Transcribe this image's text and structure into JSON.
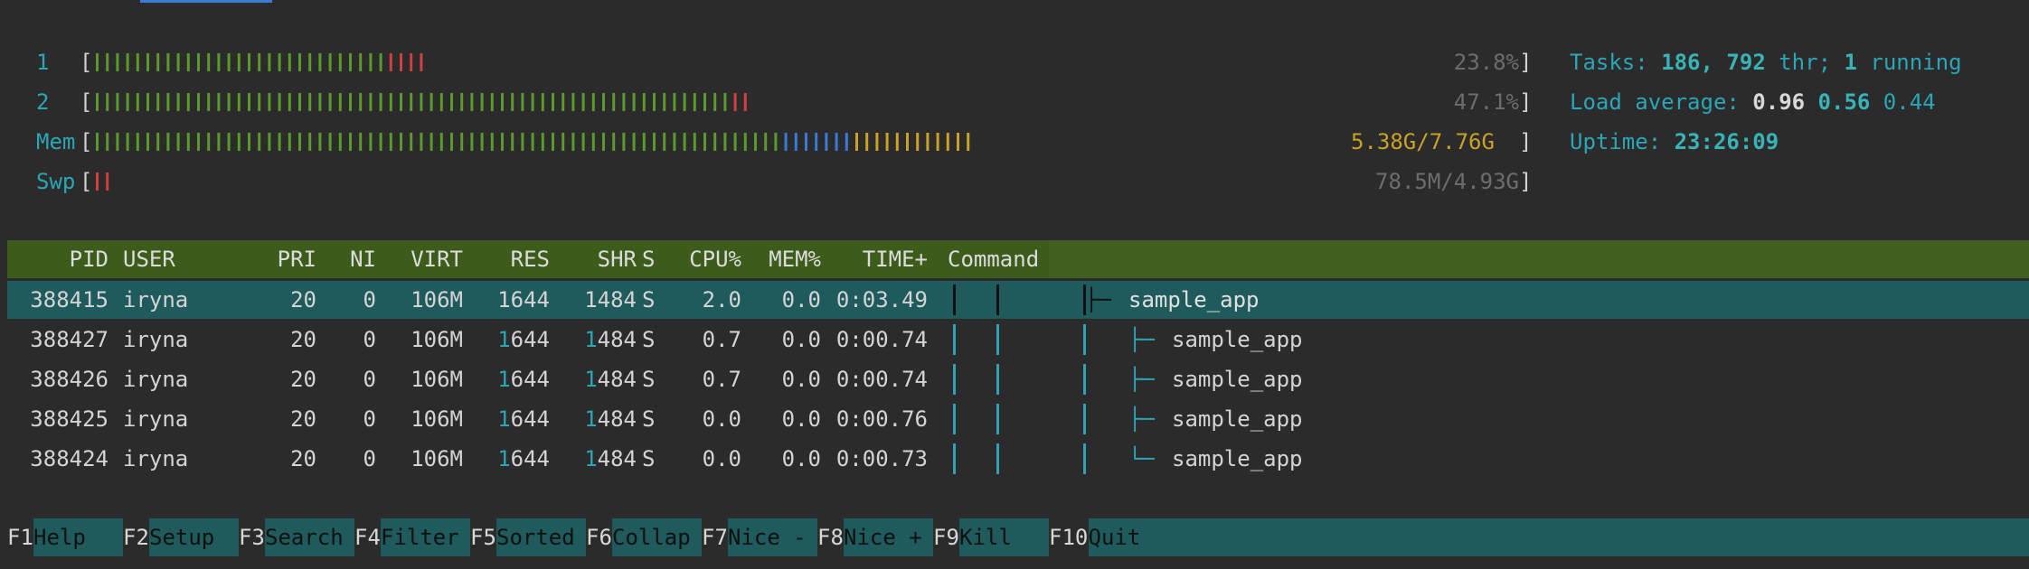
{
  "meters": {
    "cpu1": {
      "label": "1",
      "percent": 23.8,
      "value": "23.8%"
    },
    "cpu2": {
      "label": "2",
      "percent": 47.1,
      "value": "47.1%"
    },
    "mem": {
      "label": "Mem",
      "value": "5.38G/7.76G"
    },
    "swp": {
      "label": "Swp",
      "value": "78.5M/4.93G"
    }
  },
  "stats": {
    "tasks_label": "Tasks: ",
    "tasks_count": "186",
    "tasks_sep1": ", ",
    "threads": "792",
    "tasks_sep2": " thr; ",
    "running": "1",
    "running_label": " running",
    "load_label": "Load average: ",
    "load1": "0.96",
    "load5": "0.56",
    "load15": "0.44",
    "uptime_label": "Uptime: ",
    "uptime": "23:26:09"
  },
  "columns": {
    "pid": "PID",
    "user": "USER",
    "pri": "PRI",
    "ni": "NI",
    "virt": "VIRT",
    "res": "RES",
    "shr": "SHR",
    "s": "S",
    "cpu": "CPU%",
    "mem": "MEM%",
    "time": "TIME+",
    "command": "Command"
  },
  "processes": [
    {
      "pid": "388415",
      "user": "iryna",
      "pri": "20",
      "ni": "0",
      "virt": "106M",
      "res_a": "1",
      "res_b": "644",
      "shr_a": "1",
      "shr_b": "484",
      "s": "S",
      "cpu": "2.0",
      "mem": "0.0",
      "time": "0:03.49",
      "tree": "├─",
      "command": "sample_app"
    },
    {
      "pid": "388427",
      "user": "iryna",
      "pri": "20",
      "ni": "0",
      "virt": "106M",
      "res_a": "1",
      "res_b": "644",
      "shr_a": "1",
      "shr_b": "484",
      "s": "S",
      "cpu": "0.7",
      "mem": "0.0",
      "time": "0:00.74",
      "tree": "├─",
      "command": "sample_app"
    },
    {
      "pid": "388426",
      "user": "iryna",
      "pri": "20",
      "ni": "0",
      "virt": "106M",
      "res_a": "1",
      "res_b": "644",
      "shr_a": "1",
      "shr_b": "484",
      "s": "S",
      "cpu": "0.7",
      "mem": "0.0",
      "time": "0:00.74",
      "tree": "├─",
      "command": "sample_app"
    },
    {
      "pid": "388425",
      "user": "iryna",
      "pri": "20",
      "ni": "0",
      "virt": "106M",
      "res_a": "1",
      "res_b": "644",
      "shr_a": "1",
      "shr_b": "484",
      "s": "S",
      "cpu": "0.0",
      "mem": "0.0",
      "time": "0:00.76",
      "tree": "├─",
      "command": "sample_app"
    },
    {
      "pid": "388424",
      "user": "iryna",
      "pri": "20",
      "ni": "0",
      "virt": "106M",
      "res_a": "1",
      "res_b": "644",
      "shr_a": "1",
      "shr_b": "484",
      "s": "S",
      "cpu": "0.0",
      "mem": "0.0",
      "time": "0:00.73",
      "tree": "└─",
      "command": "sample_app"
    }
  ],
  "fkeys": [
    {
      "key": "F1",
      "label": "Help"
    },
    {
      "key": "F2",
      "label": "Setup"
    },
    {
      "key": "F3",
      "label": "Search"
    },
    {
      "key": "F4",
      "label": "Filter"
    },
    {
      "key": "F5",
      "label": "Sorted"
    },
    {
      "key": "F6",
      "label": "Collap"
    },
    {
      "key": "F7",
      "label": "Nice -"
    },
    {
      "key": "F8",
      "label": "Nice +"
    },
    {
      "key": "F9",
      "label": "Kill"
    },
    {
      "key": "F10",
      "label": "Quit"
    }
  ],
  "colors": {
    "bar_green": "#5a9a2a",
    "bar_red": "#d04040",
    "bar_blue": "#3a7bd5",
    "bar_yellow": "#c9a227",
    "header_bg": "#3d5c1c",
    "selected_bg": "#1f5a5c",
    "cyan": "#2aa6b6"
  }
}
